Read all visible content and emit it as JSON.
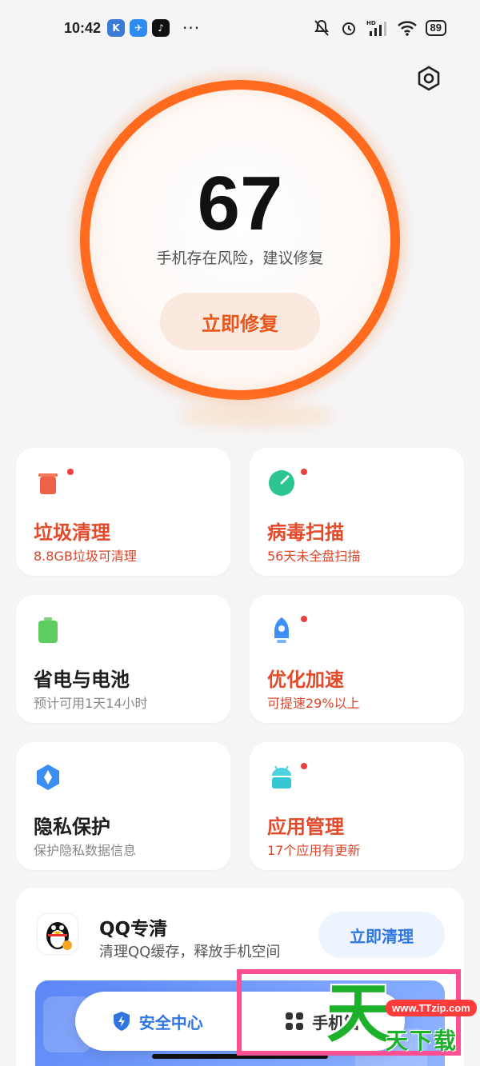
{
  "status_bar": {
    "time": "10:42",
    "app_badges": [
      {
        "icon": "k-app-icon",
        "letter": "K",
        "color": "#3a7bd5"
      },
      {
        "icon": "feather-app-icon",
        "letter": "✈",
        "color": "#2d8cf0"
      },
      {
        "icon": "tiktok-icon",
        "letter": "♪",
        "color": "#111111"
      }
    ],
    "more": "···",
    "network": "HD",
    "battery": "89"
  },
  "score": {
    "value": "67",
    "message": "手机存在风险，建议修复",
    "action_label": "立即修复"
  },
  "tools": [
    {
      "title": "垃圾清理",
      "subtitle": "8.8GB垃圾可清理",
      "icon": "trash-icon",
      "alert": true,
      "title_color": "red"
    },
    {
      "title": "病毒扫描",
      "subtitle": "56天未全盘扫描",
      "icon": "virus-scan-icon",
      "alert": true,
      "title_color": "red"
    },
    {
      "title": "省电与电池",
      "subtitle": "预计可用1天14小时",
      "icon": "battery-icon",
      "alert": false,
      "title_color": "dark"
    },
    {
      "title": "优化加速",
      "subtitle": "可提速29%以上",
      "icon": "rocket-icon",
      "alert": true,
      "title_color": "red"
    },
    {
      "title": "隐私保护",
      "subtitle": "保护隐私数据信息",
      "icon": "privacy-icon",
      "alert": false,
      "title_color": "dark"
    },
    {
      "title": "应用管理",
      "subtitle": "17个应用有更新",
      "icon": "android-icon",
      "alert": true,
      "title_color": "red"
    }
  ],
  "qq_clean": {
    "title": "QQ专清",
    "subtitle": "清理QQ缓存，释放手机空间",
    "action_label": "立即清理"
  },
  "bottom_nav": {
    "items": [
      {
        "label": "安全中心",
        "icon": "shield-icon",
        "active": true
      },
      {
        "label": "手机管",
        "icon": "grid-icon",
        "active": false
      }
    ]
  },
  "watermark": {
    "big": "天",
    "url": "www.TTzip.com",
    "sub": "天下载"
  },
  "colors": {
    "accent_orange": "#ff6a1f",
    "alert_red": "#e34a2a",
    "nav_blue": "#2f76e3"
  }
}
